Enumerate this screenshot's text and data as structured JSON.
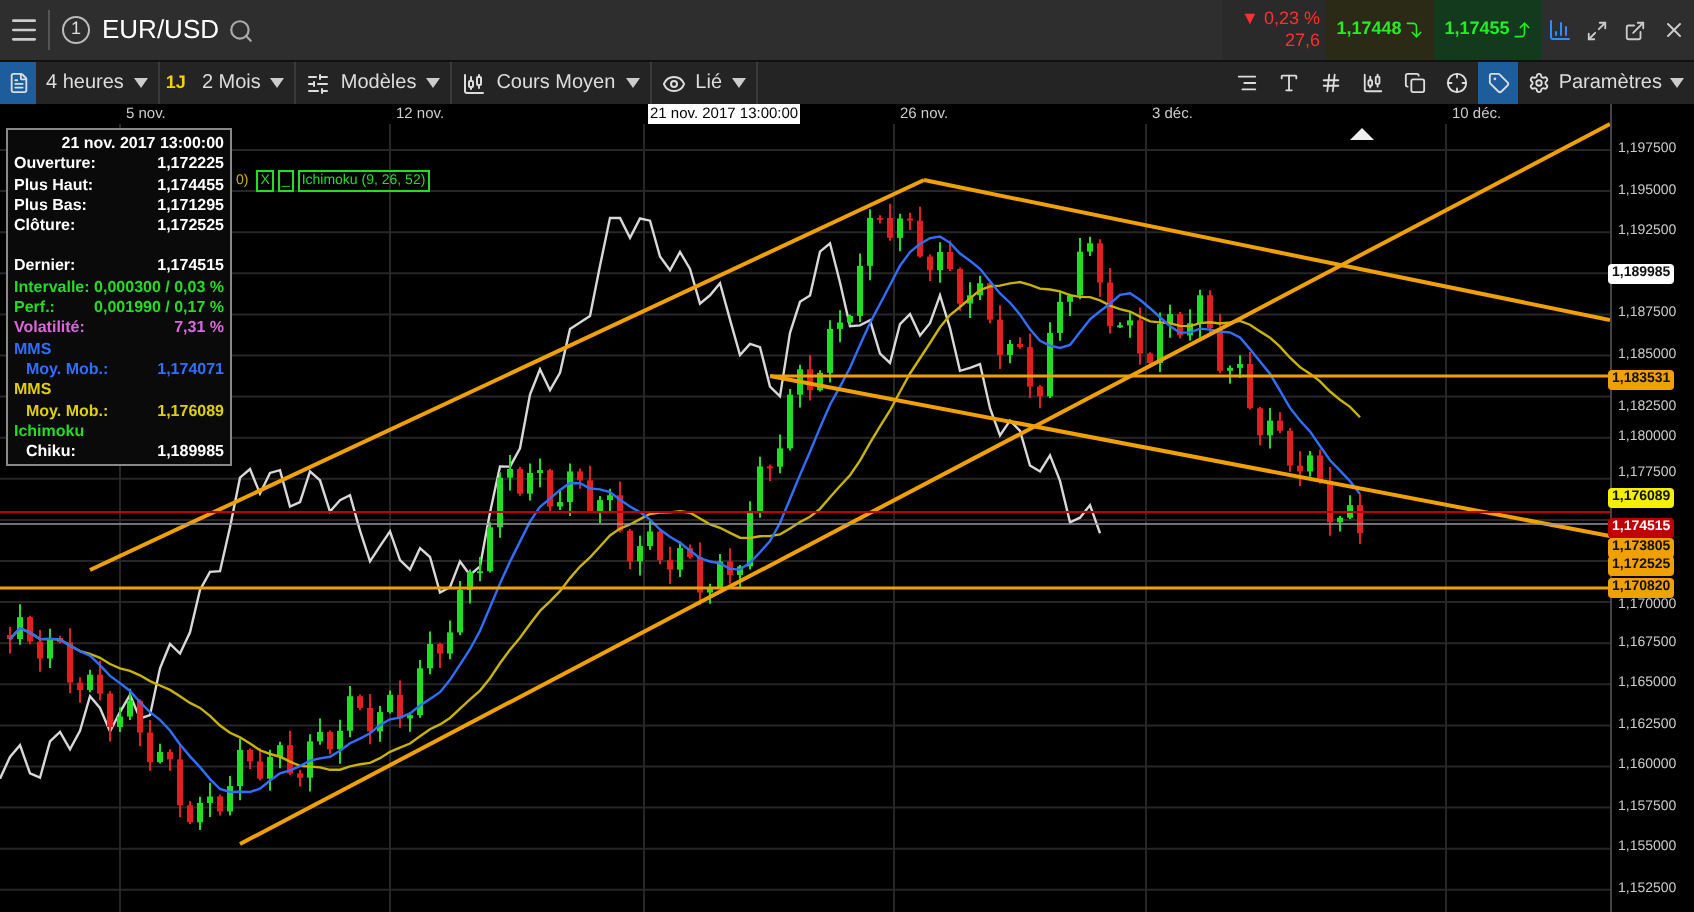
{
  "header": {
    "badge": "1",
    "symbol": "EUR/USD",
    "change": {
      "arrow": "▼",
      "percent": "0,23 %",
      "points": "27,6"
    },
    "quotes": [
      {
        "price": "1,17448"
      },
      {
        "price": "1,17455"
      }
    ]
  },
  "toolbar": {
    "items": [
      {
        "kind": "dropdown",
        "label": "4 heures"
      },
      {
        "kind": "tag",
        "label": "1J"
      },
      {
        "kind": "dropdown",
        "label": "2 Mois"
      },
      {
        "kind": "dropdown",
        "label": "Modèles"
      },
      {
        "kind": "dropdown",
        "label": "Cours Moyen"
      },
      {
        "kind": "dropdown",
        "label": "Lié"
      }
    ],
    "settings": {
      "label": "Paramètres"
    }
  },
  "time_axis": [
    {
      "label": "5 nov.",
      "selected": false
    },
    {
      "label": "12 nov.",
      "selected": false
    },
    {
      "label": "21 nov. 2017 13:00:00",
      "selected": true
    },
    {
      "label": "26 nov.",
      "selected": false
    },
    {
      "label": "3 déc.",
      "selected": false
    },
    {
      "label": "10 déc.",
      "selected": false
    }
  ],
  "legend": [
    {
      "kind": "fragment",
      "label": "0)",
      "color": "#c8b400"
    },
    {
      "kind": "full",
      "toggle": "X",
      "dash": "_",
      "label": "Ichimoku (9, 26, 52)",
      "color": "#22dd22"
    }
  ],
  "info_panel": {
    "timestamp": "21 nov. 2017 13:00:00",
    "rows": [
      {
        "kind": "value",
        "label": "Ouverture:",
        "value": "1,172225",
        "color": "#ffffff"
      },
      {
        "kind": "value",
        "label": "Plus Haut:",
        "value": "1,174455",
        "color": "#ffffff"
      },
      {
        "kind": "value",
        "label": "Plus Bas:",
        "value": "1,171295",
        "color": "#ffffff"
      },
      {
        "kind": "value",
        "label": "Clôture:",
        "value": "1,172525",
        "color": "#ffffff"
      },
      {
        "kind": "spacer"
      },
      {
        "kind": "value",
        "label": "Dernier:",
        "value": "1,174515",
        "color": "#ffffff"
      },
      {
        "kind": "value",
        "label": "Intervalle:",
        "value": "0,000300 / 0,03 %",
        "color": "#22dd22"
      },
      {
        "kind": "value",
        "label": "Perf.:",
        "value": "0,001990 / 0,17 %",
        "color": "#22dd22"
      },
      {
        "kind": "value",
        "label": "Volatilité:",
        "value": "7,31 %",
        "color": "#dd66dd"
      },
      {
        "kind": "heading",
        "label": "MMS",
        "color": "#2f6fff"
      },
      {
        "kind": "indented",
        "label": "Moy. Mob.:",
        "value": "1,174071",
        "color": "#2f6fff"
      },
      {
        "kind": "heading",
        "label": "MMS",
        "color": "#e0d000"
      },
      {
        "kind": "indented",
        "label": "Moy. Mob.:",
        "value": "1,176089",
        "color": "#e0d000"
      },
      {
        "kind": "heading",
        "label": "Ichimoku",
        "color": "#22dd22"
      },
      {
        "kind": "indented",
        "label": "Chiku:",
        "value": "1,189985",
        "color": "#ffffff"
      }
    ]
  },
  "price_axis": {
    "labels": [
      "1,197500",
      "1,195000",
      "1,192500",
      "1,187500",
      "1,185000",
      "1,182500",
      "1,180000",
      "1,177500",
      "1,170000",
      "1,167500",
      "1,165000",
      "1,162500",
      "1,160000",
      "1,157500",
      "1,155000",
      "1,152500"
    ],
    "tags": [
      {
        "value": "1,189985",
        "color": "#ffffff"
      },
      {
        "value": "1,183531",
        "color": "#f0a000"
      },
      {
        "value": "1,176089",
        "color": "#f5f000"
      },
      {
        "value": "1,174515",
        "color": "#c00000"
      },
      {
        "value": "1,173805",
        "color": "#f0a000"
      },
      {
        "value": "1,172525",
        "color": "#f0a000"
      },
      {
        "value": "1,170820",
        "color": "#f0a000"
      }
    ]
  }
}
